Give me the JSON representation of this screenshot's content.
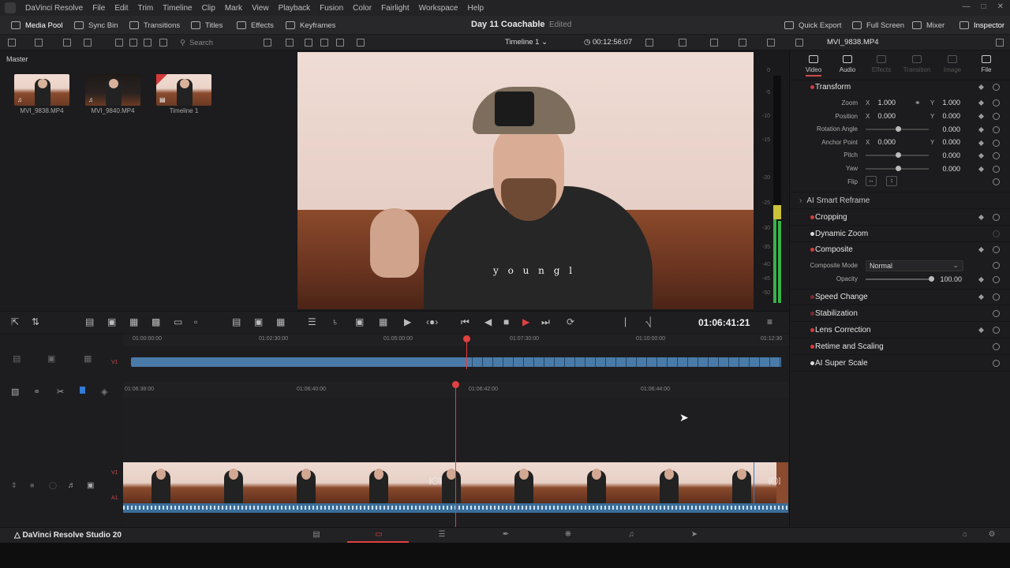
{
  "menubar": {
    "app": "DaVinci Resolve",
    "items": [
      "File",
      "Edit",
      "Trim",
      "Timeline",
      "Clip",
      "Mark",
      "View",
      "Playback",
      "Fusion",
      "Color",
      "Fairlight",
      "Workspace",
      "Help"
    ]
  },
  "toolbar": {
    "media_pool": "Media Pool",
    "sync_bin": "Sync Bin",
    "transitions": "Transitions",
    "titles": "Titles",
    "effects": "Effects",
    "keyframes": "Keyframes",
    "project_title": "Day 11 Coachable",
    "edited": "Edited",
    "quick_export": "Quick Export",
    "full_screen": "Full Screen",
    "mixer": "Mixer",
    "inspector": "Inspector"
  },
  "subbar": {
    "search_placeholder": "Search",
    "timeline_name": "Timeline 1",
    "timecode": "00:12:56:07",
    "clip_name": "MVI_9838.MP4"
  },
  "media_pool": {
    "bin": "Master",
    "clips": [
      {
        "name": "MVI_9838.MP4",
        "type": "audio-video"
      },
      {
        "name": "MVI_9840.MP4",
        "type": "audio-video"
      },
      {
        "name": "Timeline 1",
        "type": "timeline"
      }
    ]
  },
  "viewer": {
    "shirt_text": "y o u n g l"
  },
  "meter": {
    "ticks": [
      "0",
      "-5",
      "-10",
      "-15",
      "-20",
      "-25",
      "-30",
      "-35",
      "-40",
      "-45",
      "-50"
    ]
  },
  "transport": {
    "timecode": "01:06:41:21"
  },
  "inspector": {
    "tabs": [
      {
        "label": "Video",
        "active": true
      },
      {
        "label": "Audio",
        "active": true
      },
      {
        "label": "Effects",
        "active": false
      },
      {
        "label": "Transition",
        "active": false
      },
      {
        "label": "Image",
        "active": false
      },
      {
        "label": "File",
        "active": true
      }
    ],
    "transform": "Transform",
    "zoom": {
      "label": "Zoom",
      "x": "1.000",
      "y": "1.000"
    },
    "position": {
      "label": "Position",
      "x": "0.000",
      "y": "0.000"
    },
    "rotation": {
      "label": "Rotation Angle",
      "value": "0.000"
    },
    "anchor": {
      "label": "Anchor Point",
      "x": "0.000",
      "y": "0.000"
    },
    "pitch": {
      "label": "Pitch",
      "value": "0.000"
    },
    "yaw": {
      "label": "Yaw",
      "value": "0.000"
    },
    "flip": {
      "label": "Flip"
    },
    "x_axis": "X",
    "y_axis": "Y",
    "ai_reframe": "AI Smart Reframe",
    "cropping": "Cropping",
    "dynamic_zoom": "Dynamic Zoom",
    "composite": "Composite",
    "composite_mode": {
      "label": "Composite Mode",
      "value": "Normal"
    },
    "opacity": {
      "label": "Opacity",
      "value": "100.00"
    },
    "speed_change": "Speed Change",
    "stabilization": "Stabilization",
    "lens_correction": "Lens Correction",
    "retime": "Retime and Scaling",
    "super_scale": "AI Super Scale"
  },
  "timeline": {
    "ruler1": [
      "01:00:00:00",
      "01:02:30:00",
      "01:05:00:00",
      "01:07:30:00",
      "01:10:00:00",
      "01:12:30"
    ],
    "ruler2": [
      "01:06:38:00",
      "01:06:40:00",
      "01:06:42:00",
      "01:06:44:00"
    ],
    "track_v1": "V1",
    "track_a1": "A1"
  },
  "bottombar": {
    "brand": "DaVinci Resolve Studio 20"
  }
}
